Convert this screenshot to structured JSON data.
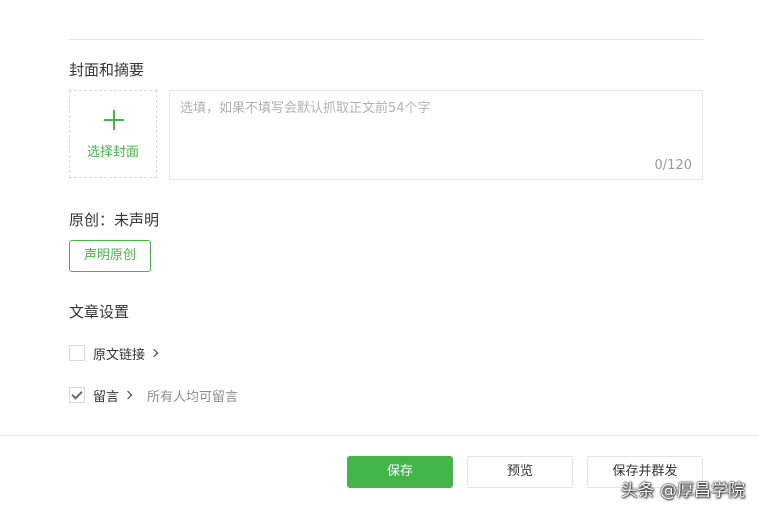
{
  "cover_summary": {
    "title": "封面和摘要",
    "cover_button_label": "选择封面",
    "summary_placeholder": "选填，如果不填写会默认抓取正文前54个字",
    "summary_counter": "0/120"
  },
  "original": {
    "status": "原创：未声明",
    "declare_button": "声明原创"
  },
  "settings": {
    "title": "文章设置",
    "source_link": {
      "label": "原文链接",
      "checked": false
    },
    "comments": {
      "label": "留言",
      "checked": true,
      "description": "所有人均可留言"
    }
  },
  "footer": {
    "save_label": "保存",
    "preview_label": "预览",
    "publish_label": "保存并群发"
  },
  "watermark": "头条 @厚昌学院",
  "colors": {
    "accent": "#44b549",
    "border": "#e7e7eb"
  }
}
